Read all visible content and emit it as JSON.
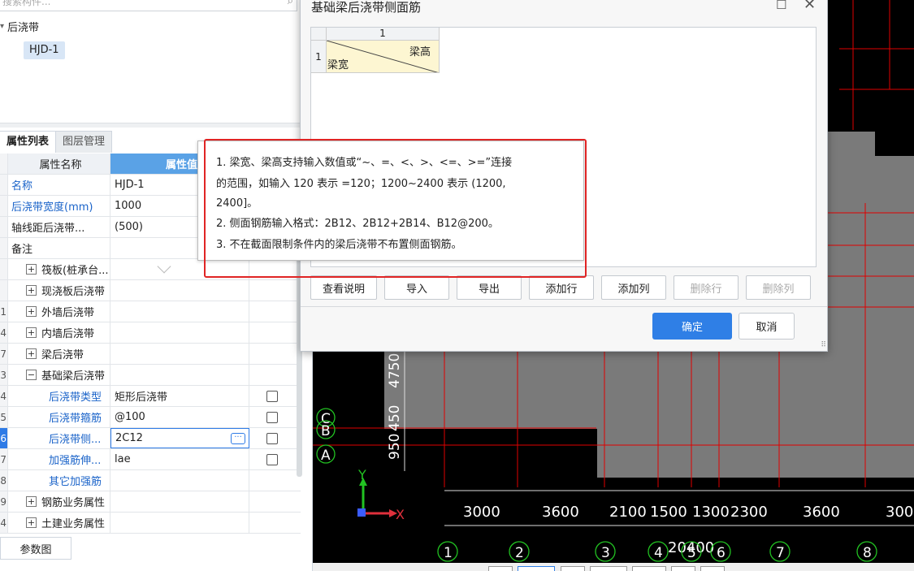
{
  "left_panel": {
    "search_placeholder": "搜索构件...",
    "tree_group": "后浇带",
    "tree_item": "HJD-1",
    "tabs": [
      "属性列表",
      "图层管理"
    ],
    "table_header": {
      "name": "属性名称",
      "value": "属性值"
    },
    "rows": [
      {
        "num": "",
        "name": "名称",
        "value": "HJD-1",
        "style": "blue",
        "expand": "",
        "check": false
      },
      {
        "num": "",
        "name": "后浇带宽度(mm)",
        "value": "1000",
        "style": "blue",
        "expand": "",
        "check": false
      },
      {
        "num": "",
        "name": "轴线距后浇带...",
        "value": "(500)",
        "style": "",
        "expand": "",
        "check": false
      },
      {
        "num": "",
        "name": "备注",
        "value": "",
        "style": "",
        "expand": "",
        "check": false
      },
      {
        "num": "",
        "name": "筏板(桩承台...",
        "value": "",
        "style": "sub",
        "expand": "+",
        "check": false
      },
      {
        "num": "",
        "name": "现浇板后浇带",
        "value": "",
        "style": "sub",
        "expand": "+",
        "check": false
      },
      {
        "num": "1",
        "name": "外墙后浇带",
        "value": "",
        "style": "sub",
        "expand": "+",
        "check": false
      },
      {
        "num": "4",
        "name": "内墙后浇带",
        "value": "",
        "style": "sub",
        "expand": "+",
        "check": false
      },
      {
        "num": "7",
        "name": "梁后浇带",
        "value": "",
        "style": "sub",
        "expand": "+",
        "check": false
      },
      {
        "num": "3",
        "name": "基础梁后浇带",
        "value": "",
        "style": "sub",
        "expand": "−",
        "check": false
      },
      {
        "num": "4",
        "name": "后浇带类型",
        "value": "矩形后浇带",
        "style": "sub2",
        "expand": "",
        "check": true
      },
      {
        "num": "5",
        "name": "后浇带箍筋",
        "value": "@100",
        "style": "sub2",
        "expand": "",
        "check": true
      },
      {
        "num": "6",
        "name": "后浇带侧...",
        "value": "2C12",
        "style": "sub2",
        "expand": "",
        "check": true,
        "selected": true
      },
      {
        "num": "7",
        "name": "加强筋伸...",
        "value": "lae",
        "style": "sub2",
        "expand": "",
        "check": true
      },
      {
        "num": "8",
        "name": "其它加强筋",
        "value": "",
        "style": "sub2",
        "expand": "",
        "check": false
      },
      {
        "num": "9",
        "name": "钢筋业务属性",
        "value": "",
        "style": "sub",
        "expand": "+",
        "check": false
      },
      {
        "num": "4",
        "name": "土建业务属性",
        "value": "",
        "style": "sub",
        "expand": "+",
        "check": false
      }
    ],
    "param_button": "参数图"
  },
  "dialog": {
    "title": "基础梁后浇带侧面筋",
    "grid": {
      "col_header": "1",
      "row_header": "1",
      "cell_top": "梁高",
      "cell_bottom": "梁宽"
    },
    "buttons": [
      "查看说明",
      "导入",
      "导出",
      "添加行",
      "添加列",
      "删除行",
      "删除列"
    ],
    "disabled_buttons": [
      "删除行",
      "删除列"
    ],
    "ok": "确定",
    "cancel": "取消"
  },
  "tooltip": {
    "lines": [
      "1. 梁宽、梁高支持输入数值或“~、=、<、>、<=、>=”连接",
      "的范围，如输入 120 表示 =120；1200~2400 表示 (1200,",
      "2400]。",
      "2. 侧面钢筋输入格式：2B12、2B12+2B14、B12@200。",
      "3. 不在截面限制条件内的梁后浇带不布置侧面钢筋。"
    ]
  },
  "canvas": {
    "dimensions": [
      "3000",
      "3600",
      "2100",
      "1500",
      "1300",
      "2300",
      "3600",
      "300"
    ],
    "total_dimension": "20400",
    "axis_numbers": [
      "1",
      "2",
      "3",
      "4",
      "5",
      "6",
      "7",
      "8"
    ],
    "axis_letters": [
      "C",
      "B",
      "A"
    ],
    "vertical_dims": [
      "4750",
      "450",
      "950"
    ],
    "ucs_x": "X",
    "ucs_y": "Y"
  },
  "colors": {
    "accent": "#2f7fe6",
    "highlight_border": "#e02424",
    "canvas_bg": "#000000",
    "grid_red": "#e00000"
  }
}
